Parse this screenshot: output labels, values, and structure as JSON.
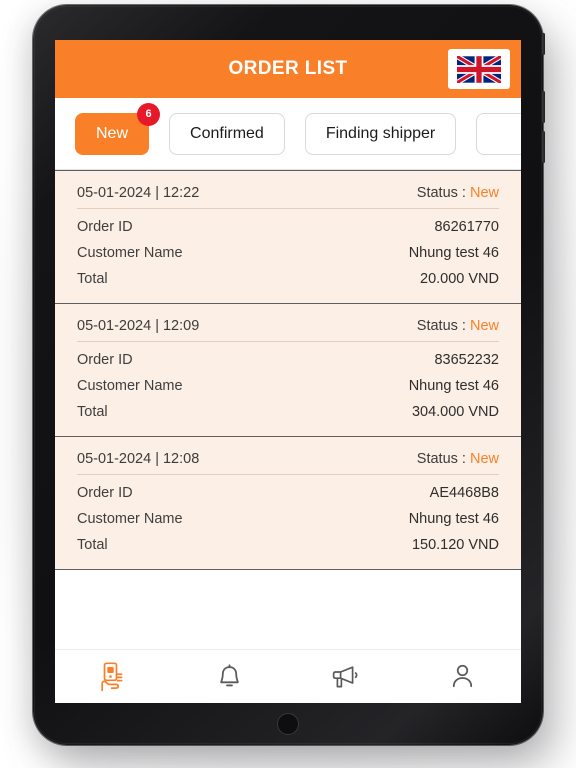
{
  "header": {
    "title": "ORDER LIST",
    "language_icon": "flag-uk-icon"
  },
  "tabs": [
    {
      "label": "New",
      "active": true,
      "badge": "6"
    },
    {
      "label": "Confirmed",
      "active": false,
      "badge": ""
    },
    {
      "label": "Finding shipper",
      "active": false,
      "badge": ""
    },
    {
      "label": "",
      "active": false,
      "badge": ""
    }
  ],
  "labels": {
    "order_id": "Order ID",
    "customer_name": "Customer Name",
    "total": "Total",
    "status_prefix": "Status :"
  },
  "orders": [
    {
      "datetime": "05-01-2024 | 12:22",
      "status": "New",
      "order_id": "86261770",
      "customer_name": "Nhung test 46",
      "total": "20.000 VND"
    },
    {
      "datetime": "05-01-2024 | 12:09",
      "status": "New",
      "order_id": "83652232",
      "customer_name": "Nhung test 46",
      "total": "304.000 VND"
    },
    {
      "datetime": "05-01-2024 | 12:08",
      "status": "New",
      "order_id": "AE4468B8",
      "customer_name": "Nhung test 46",
      "total": "150.120 VND"
    }
  ],
  "bottom_nav": [
    {
      "icon": "hand-holding-phone-icon",
      "active": true
    },
    {
      "icon": "bell-icon",
      "active": false
    },
    {
      "icon": "megaphone-icon",
      "active": false
    },
    {
      "icon": "person-icon",
      "active": false
    }
  ],
  "colors": {
    "brand_orange": "#F98028",
    "badge_red": "#E8182B",
    "card_bg": "#FCEFE5",
    "status_new": "#F98028"
  }
}
